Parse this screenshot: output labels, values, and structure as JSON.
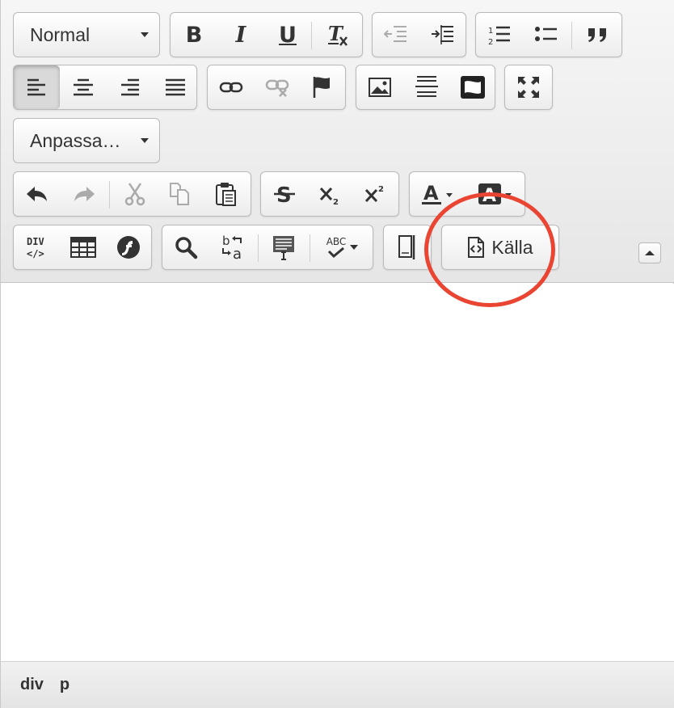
{
  "toolbar": {
    "format_value": "Normal",
    "styles_value": "Anpassa…",
    "bold_label": "B",
    "italic_label": "I",
    "underline_label": "U",
    "source_label": "Källa",
    "div_label": "DIV",
    "spellcheck_label": "ABC"
  },
  "statusbar": {
    "path": [
      "div",
      "p"
    ]
  },
  "colors": {
    "annotation": "#e94532",
    "text": "#333333",
    "toolbar_bg": "#eeeeee"
  }
}
